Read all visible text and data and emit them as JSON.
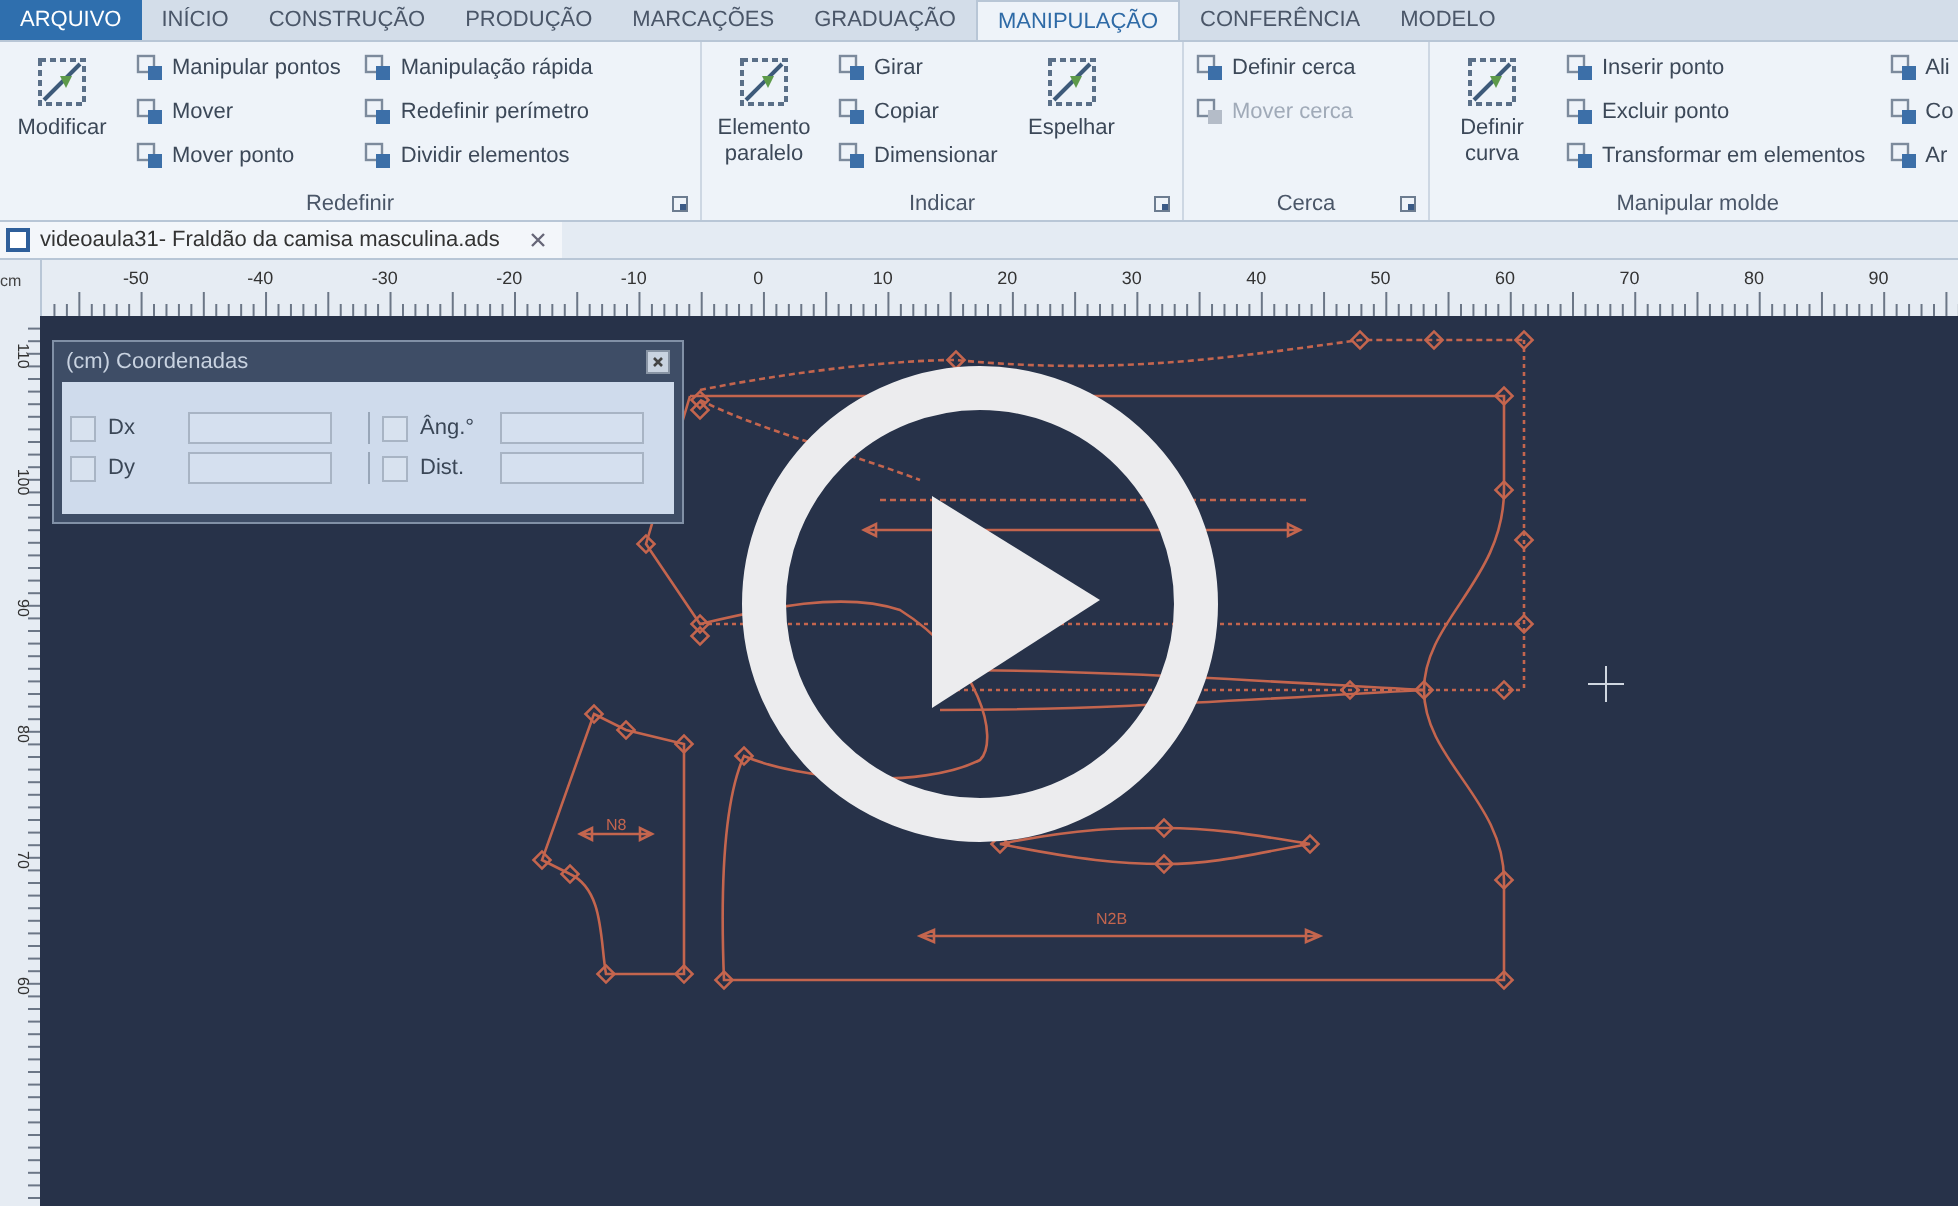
{
  "menu_tabs": [
    {
      "label": "ARQUIVO",
      "kind": "file",
      "selected": false
    },
    {
      "label": "INÍCIO",
      "kind": "tab",
      "selected": false
    },
    {
      "label": "CONSTRUÇÃO",
      "kind": "tab",
      "selected": false
    },
    {
      "label": "PRODUÇÃO",
      "kind": "tab",
      "selected": false
    },
    {
      "label": "MARCAÇÕES",
      "kind": "tab",
      "selected": false
    },
    {
      "label": "GRADUAÇÃO",
      "kind": "tab",
      "selected": false
    },
    {
      "label": "MANIPULAÇÃO",
      "kind": "tab",
      "selected": true
    },
    {
      "label": "CONFERÊNCIA",
      "kind": "tab",
      "selected": false
    },
    {
      "label": "MODELO",
      "kind": "tab",
      "selected": false
    }
  ],
  "ribbon": {
    "groups": [
      {
        "title": "Redefinir",
        "launcher": true,
        "items": [
          {
            "label": "Modificar",
            "kind": "large",
            "disabled": false
          },
          {
            "label": "Manipular pontos",
            "kind": "small",
            "disabled": false
          },
          {
            "label": "Mover",
            "kind": "small",
            "disabled": false
          },
          {
            "label": "Mover ponto",
            "kind": "small",
            "disabled": false
          },
          {
            "label": "Manipulação rápida",
            "kind": "small",
            "disabled": false
          },
          {
            "label": "Redefinir perímetro",
            "kind": "small",
            "disabled": false
          },
          {
            "label": "Dividir elementos",
            "kind": "small",
            "disabled": false
          }
        ]
      },
      {
        "title": "Indicar",
        "launcher": true,
        "items": [
          {
            "label": "Elemento paralelo",
            "kind": "large",
            "disabled": false
          },
          {
            "label": "Girar",
            "kind": "small",
            "disabled": false
          },
          {
            "label": "Copiar",
            "kind": "small",
            "disabled": false
          },
          {
            "label": "Dimensionar",
            "kind": "small",
            "disabled": false
          },
          {
            "label": "Espelhar",
            "kind": "large",
            "disabled": false
          }
        ]
      },
      {
        "title": "Cerca",
        "launcher": true,
        "items": [
          {
            "label": "Definir cerca",
            "kind": "small",
            "disabled": false
          },
          {
            "label": "Mover cerca",
            "kind": "small",
            "disabled": true
          }
        ]
      },
      {
        "title": "Manipular molde",
        "launcher": false,
        "items": [
          {
            "label": "Definir curva",
            "kind": "large",
            "disabled": false
          },
          {
            "label": "Inserir ponto",
            "kind": "small",
            "disabled": false
          },
          {
            "label": "Excluir ponto",
            "kind": "small",
            "disabled": false
          },
          {
            "label": "Transformar em elementos",
            "kind": "small",
            "disabled": false
          },
          {
            "label": "Ali",
            "kind": "small",
            "disabled": false
          },
          {
            "label": "Co",
            "kind": "small",
            "disabled": false
          },
          {
            "label": "Ar",
            "kind": "small",
            "disabled": false
          }
        ]
      }
    ]
  },
  "document_tab": {
    "title": "videoaula31- Fraldão da camisa masculina.ads"
  },
  "ruler": {
    "unit": "cm",
    "x_labels": [
      "-50",
      "-40",
      "-30",
      "-20",
      "-10",
      "0",
      "10",
      "20",
      "30",
      "40",
      "50",
      "60",
      "70",
      "80",
      "90"
    ],
    "y_labels": [
      "110",
      "100",
      "90",
      "80",
      "70",
      "60"
    ]
  },
  "coordinates_panel": {
    "title": "(cm) Coordenadas",
    "fields": [
      {
        "label": "Dx",
        "checked": false
      },
      {
        "label": "Dy",
        "checked": false
      },
      {
        "label": "Âng.°",
        "checked": false
      },
      {
        "label": "Dist.",
        "checked": false
      }
    ]
  },
  "pattern_labels": [
    "N8",
    "N2B"
  ]
}
